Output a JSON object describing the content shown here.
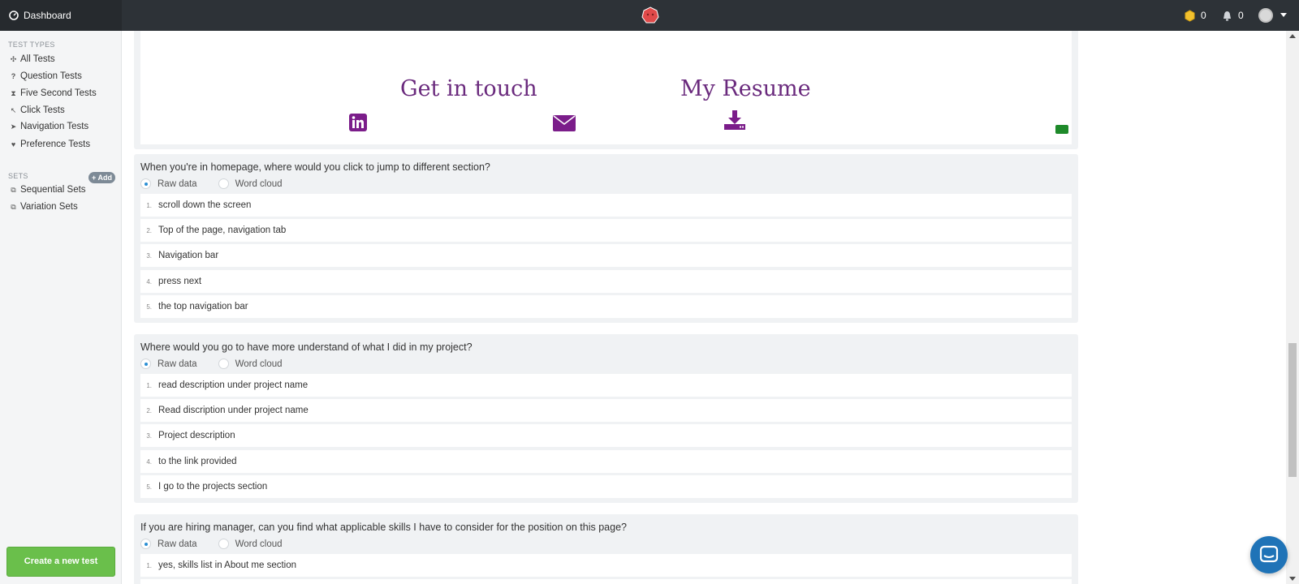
{
  "topbar": {
    "dashboard_label": "Dashboard",
    "coins_count": "0",
    "notifications_count": "0"
  },
  "sidebar": {
    "test_types_heading": "TEST TYPES",
    "test_types": [
      {
        "label": "All Tests",
        "icon": "all-tests-icon"
      },
      {
        "label": "Question Tests",
        "icon": "question-icon"
      },
      {
        "label": "Five Second Tests",
        "icon": "hourglass-icon"
      },
      {
        "label": "Click Tests",
        "icon": "cursor-icon"
      },
      {
        "label": "Navigation Tests",
        "icon": "navigation-icon"
      },
      {
        "label": "Preference Tests",
        "icon": "heart-icon"
      }
    ],
    "sets_heading": "SETS",
    "add_label": "+ Add",
    "sets": [
      {
        "label": "Sequential Sets",
        "icon": "sequential-icon"
      },
      {
        "label": "Variation Sets",
        "icon": "variation-icon"
      }
    ],
    "create_button": "Create a new test"
  },
  "screenshot": {
    "get_in_touch": "Get in touch",
    "my_resume": "My Resume"
  },
  "questions": [
    {
      "title": "When you're in homepage, where would you click to jump to different section?",
      "options": [
        "Raw data",
        "Word cloud"
      ],
      "answers": [
        {
          "num": "1.",
          "text": "scroll down the screen"
        },
        {
          "num": "2.",
          "text": "Top of the page, navigation tab"
        },
        {
          "num": "3.",
          "text": "Navigation bar"
        },
        {
          "num": "4.",
          "text": "press next"
        },
        {
          "num": "5.",
          "text": "the top navigation bar"
        }
      ]
    },
    {
      "title": "Where would you go to have more understand of what I did in my project?",
      "options": [
        "Raw data",
        "Word cloud"
      ],
      "answers": [
        {
          "num": "1.",
          "text": "read description under project name"
        },
        {
          "num": "2.",
          "text": "Read discription under project name"
        },
        {
          "num": "3.",
          "text": "Project description"
        },
        {
          "num": "4.",
          "text": "to the link provided"
        },
        {
          "num": "5.",
          "text": "I go to the projects section"
        }
      ]
    },
    {
      "title": "If you are hiring manager, can you find what applicable skills I have to consider for the position on this page?",
      "options": [
        "Raw data",
        "Word cloud"
      ],
      "answers": [
        {
          "num": "1.",
          "text": "yes, skills list in About me section"
        }
      ]
    }
  ],
  "colors": {
    "topbar": "#2d3237",
    "accent_green": "#6abf4b",
    "resume_purple": "#6a2a7d",
    "radio_blue": "#2b8fd4",
    "chat_blue": "#1f73b7"
  }
}
